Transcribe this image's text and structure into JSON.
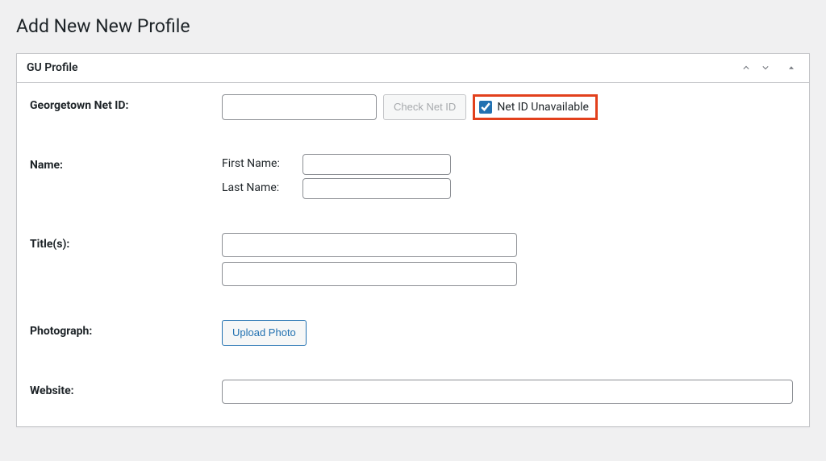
{
  "page": {
    "title": "Add New New Profile"
  },
  "metabox": {
    "title": "GU Profile"
  },
  "fields": {
    "netid": {
      "label": "Georgetown Net ID:",
      "value": "",
      "check_button": "Check Net ID",
      "unavailable_label": "Net ID Unavailable",
      "unavailable_checked": true
    },
    "name": {
      "label": "Name:",
      "first_label": "First Name:",
      "last_label": "Last Name:",
      "first_value": "",
      "last_value": ""
    },
    "titles": {
      "label": "Title(s):",
      "value1": "",
      "value2": ""
    },
    "photograph": {
      "label": "Photograph:",
      "button": "Upload Photo"
    },
    "website": {
      "label": "Website:",
      "value": ""
    }
  },
  "colors": {
    "highlight_border": "#e2401c",
    "link_blue": "#2271b1",
    "page_bg": "#f0f0f1",
    "panel_border": "#c3c4c7"
  }
}
